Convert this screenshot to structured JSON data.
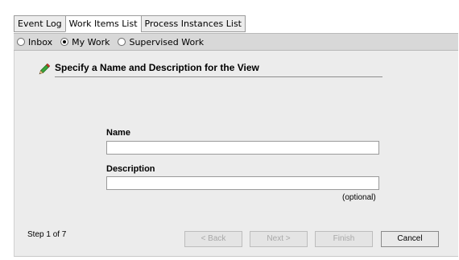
{
  "tabs": [
    {
      "label": "Event Log",
      "active": false
    },
    {
      "label": "Work Items List",
      "active": true
    },
    {
      "label": "Process Instances List",
      "active": false
    }
  ],
  "radios": [
    {
      "label": "Inbox",
      "checked": false
    },
    {
      "label": "My Work",
      "checked": true
    },
    {
      "label": "Supervised Work",
      "checked": false
    }
  ],
  "wizard": {
    "heading": "Specify a Name and Description for the View",
    "name_label": "Name",
    "name_value": "",
    "description_label": "Description",
    "description_value": "",
    "optional_hint": "(optional)",
    "step": "Step 1 of 7"
  },
  "buttons": {
    "back": "< Back",
    "next": "Next >",
    "finish": "Finish",
    "cancel": "Cancel"
  },
  "colors": {
    "panel_bg": "#ececec",
    "radio_bar_bg": "#d8d8d8",
    "pencil_green": "#3aa43a",
    "pencil_red": "#d53b2b"
  }
}
